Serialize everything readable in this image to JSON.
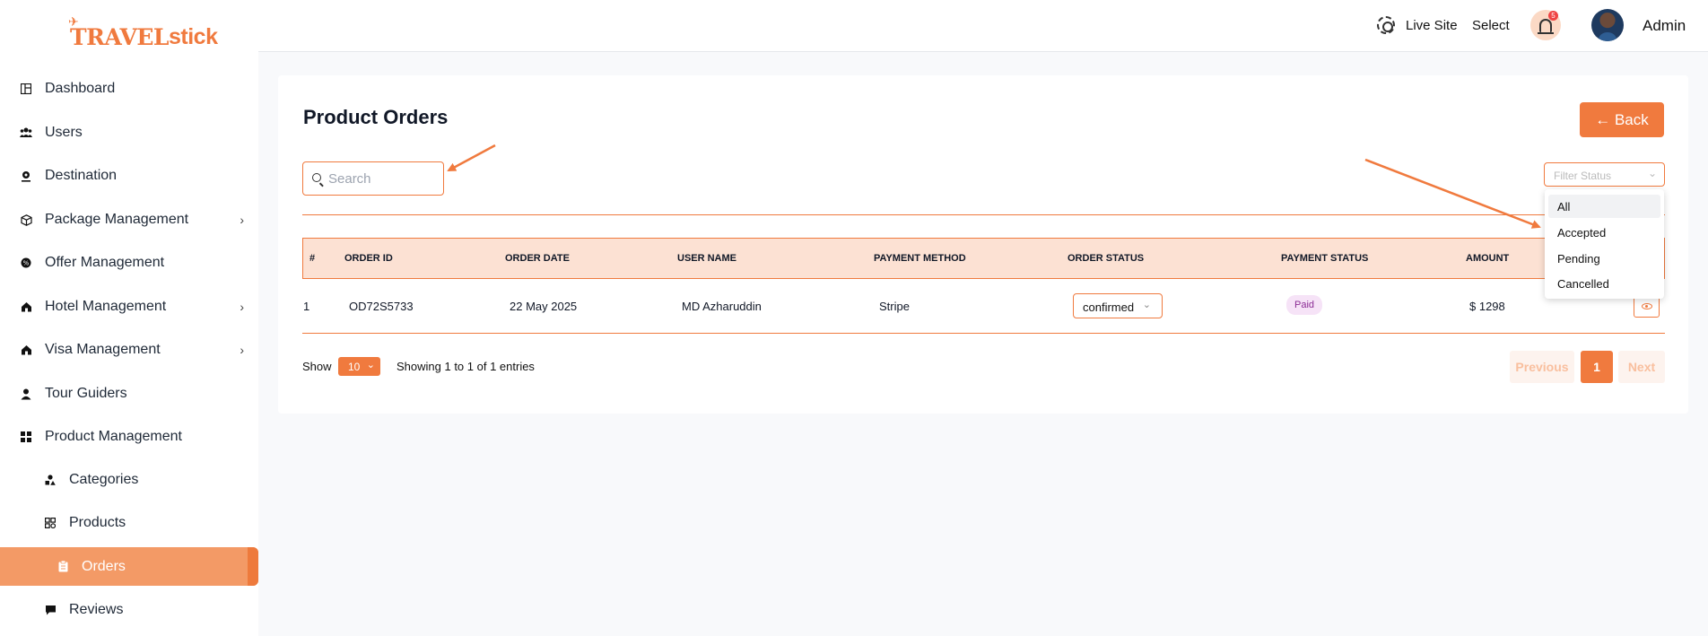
{
  "brand": {
    "part1": "TRAVEL",
    "part2": "stick",
    "color": "#f07a3e"
  },
  "sidebar": {
    "items": [
      {
        "label": "Dashboard",
        "icon": "dashboard-icon"
      },
      {
        "label": "Users",
        "icon": "users-icon"
      },
      {
        "label": "Destination",
        "icon": "location-pin-icon"
      },
      {
        "label": "Package Management",
        "icon": "package-icon",
        "has_children": true
      },
      {
        "label": "Offer Management",
        "icon": "offer-icon"
      },
      {
        "label": "Hotel Management",
        "icon": "hotel-icon",
        "has_children": true
      },
      {
        "label": "Visa Management",
        "icon": "visa-icon",
        "has_children": true
      },
      {
        "label": "Tour Guiders",
        "icon": "guide-icon"
      },
      {
        "label": "Product Management",
        "icon": "grid-icon"
      }
    ],
    "subitems": [
      {
        "label": "Categories",
        "icon": "shapes-icon"
      },
      {
        "label": "Products",
        "icon": "products-icon"
      },
      {
        "label": "Orders",
        "icon": "clipboard-icon",
        "active": true
      },
      {
        "label": "Reviews",
        "icon": "comment-icon"
      }
    ]
  },
  "header": {
    "live_site": "Live Site",
    "select": "Select",
    "notification_count": "5",
    "user_name": "Admin"
  },
  "page": {
    "title": "Product Orders",
    "back_label": "← Back",
    "search_placeholder": "Search",
    "filter_placeholder": "Filter Status"
  },
  "table": {
    "columns": [
      "#",
      "ORDER ID",
      "ORDER DATE",
      "USER NAME",
      "PAYMENT METHOD",
      "ORDER STATUS",
      "PAYMENT STATUS",
      "AMOUNT"
    ],
    "rows": [
      {
        "index": "1",
        "order_id": "OD72S5733",
        "order_date": "22 May 2025",
        "user_name": "MD Azharuddin",
        "payment_method": "Stripe",
        "order_status": "confirmed",
        "payment_status": "Paid",
        "amount": "$ 1298"
      }
    ]
  },
  "footer": {
    "show_label": "Show",
    "page_size": "10",
    "showing_text": "Showing 1 to 1 of 1 entries",
    "prev_label": "Previous",
    "current_page": "1",
    "next_label": "Next"
  },
  "filter_dropdown": {
    "options": [
      "All",
      "Accepted",
      "Pending",
      "Cancelled"
    ],
    "highlighted": "All"
  },
  "colors": {
    "accent": "#f07a3e",
    "header_bg": "#fce1d3",
    "active_nav": "#f39a66"
  }
}
